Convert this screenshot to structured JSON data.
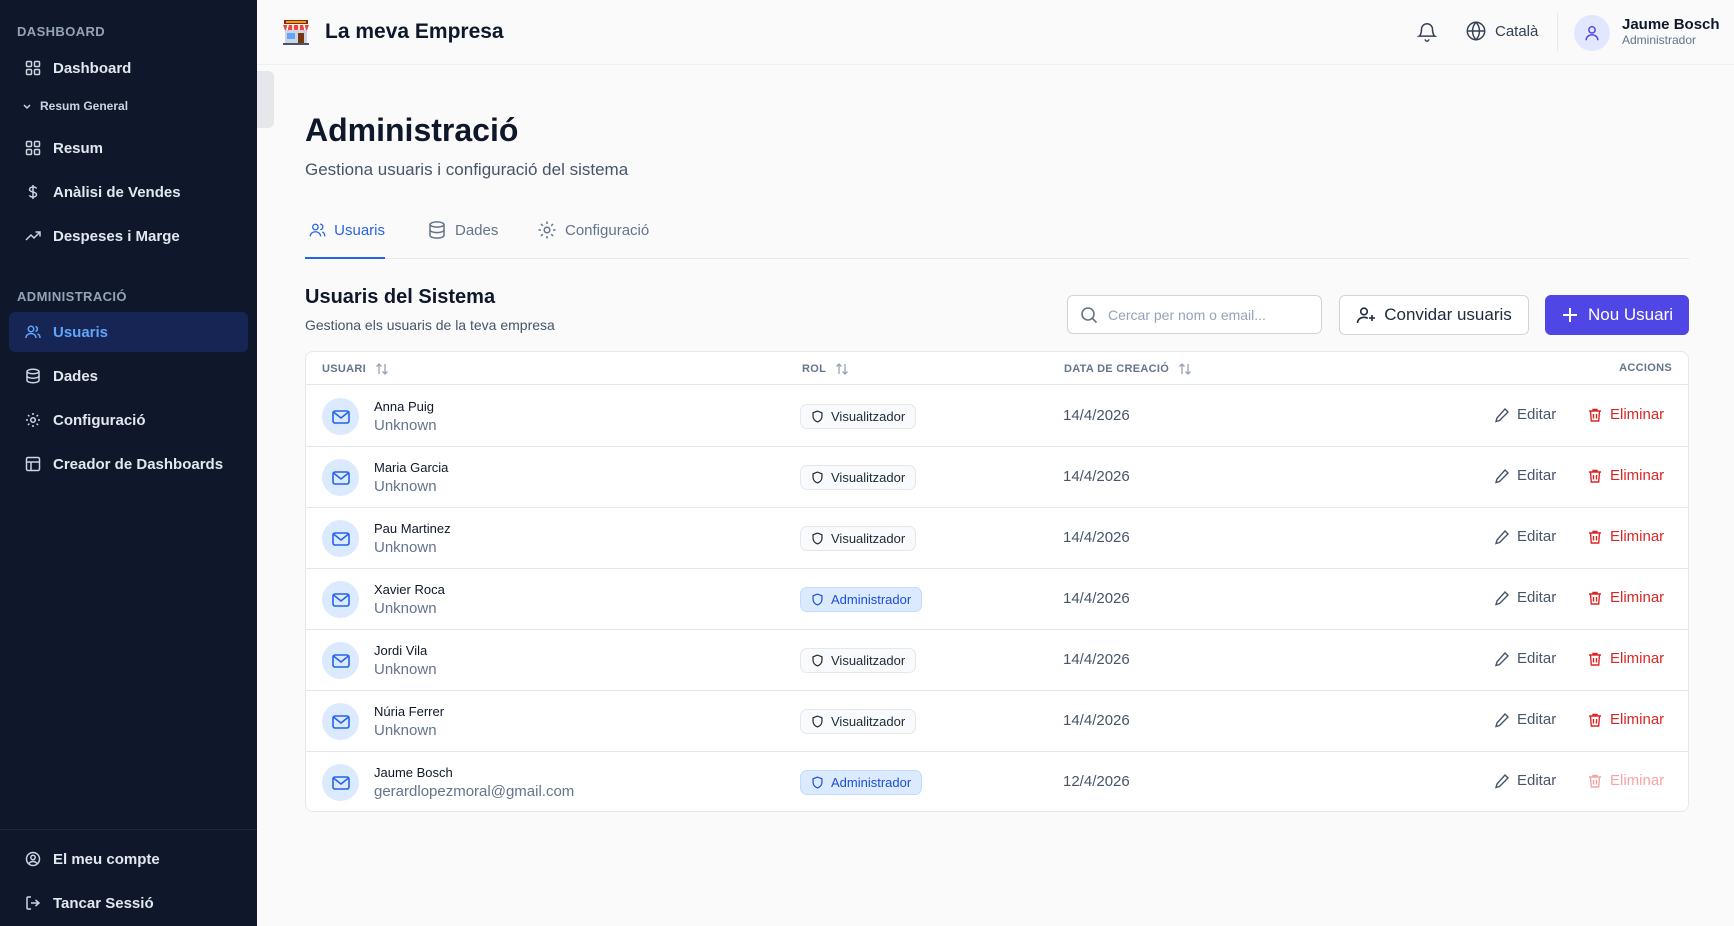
{
  "app": {
    "title": "La meva Empresa",
    "logo_icon": "storefront-icon"
  },
  "header": {
    "language": "Català",
    "user": {
      "name": "Jaume Bosch",
      "role": "Administrador"
    }
  },
  "sidebar": {
    "section_dashboard": "DASHBOARD",
    "dashboard": "Dashboard",
    "group": "Resum General",
    "resum": "Resum",
    "vendes": "Anàlisi de Vendes",
    "despeses": "Despeses i Marge",
    "section_admin": "ADMINISTRACIÓ",
    "usuaris": "Usuaris",
    "dades": "Dades",
    "configuracio": "Configuració",
    "creador": "Creador de Dashboards",
    "account": "El meu compte",
    "logout": "Tancar Sessió"
  },
  "page": {
    "title": "Administració",
    "subtitle": "Gestiona usuaris i configuració del sistema"
  },
  "tabs": {
    "usuaris": "Usuaris",
    "dades": "Dades",
    "configuracio": "Configuració"
  },
  "users_section": {
    "title": "Usuaris del Sistema",
    "subtitle": "Gestiona els usuaris de la teva empresa",
    "search_placeholder": "Cercar per nom o email...",
    "invite_button": "Convidar usuaris",
    "new_button": "Nou Usuari"
  },
  "table": {
    "headers": {
      "user": "USUARI",
      "role": "ROL",
      "date": "DATA DE CREACIÓ",
      "actions": "ACCIONS"
    },
    "edit_label": "Editar",
    "delete_label": "Eliminar",
    "rows": [
      {
        "name": "Anna Puig",
        "email": "Unknown",
        "role": "Visualitzador",
        "date": "14/4/2026"
      },
      {
        "name": "Maria Garcia",
        "email": "Unknown",
        "role": "Visualitzador",
        "date": "14/4/2026"
      },
      {
        "name": "Pau Martinez",
        "email": "Unknown",
        "role": "Visualitzador",
        "date": "14/4/2026"
      },
      {
        "name": "Xavier Roca",
        "email": "Unknown",
        "role": "Administrador",
        "date": "14/4/2026"
      },
      {
        "name": "Jordi Vila",
        "email": "Unknown",
        "role": "Visualitzador",
        "date": "14/4/2026"
      },
      {
        "name": "Núria Ferrer",
        "email": "Unknown",
        "role": "Visualitzador",
        "date": "14/4/2026"
      },
      {
        "name": "Jaume Bosch",
        "email": "gerardlopezmoral@gmail.com",
        "role": "Administrador",
        "date": "12/4/2026"
      }
    ]
  },
  "colors": {
    "sidebar_bg": "#0f172a",
    "accent": "#4f46e5",
    "active_tab": "#2563eb",
    "danger": "#dc2626"
  }
}
